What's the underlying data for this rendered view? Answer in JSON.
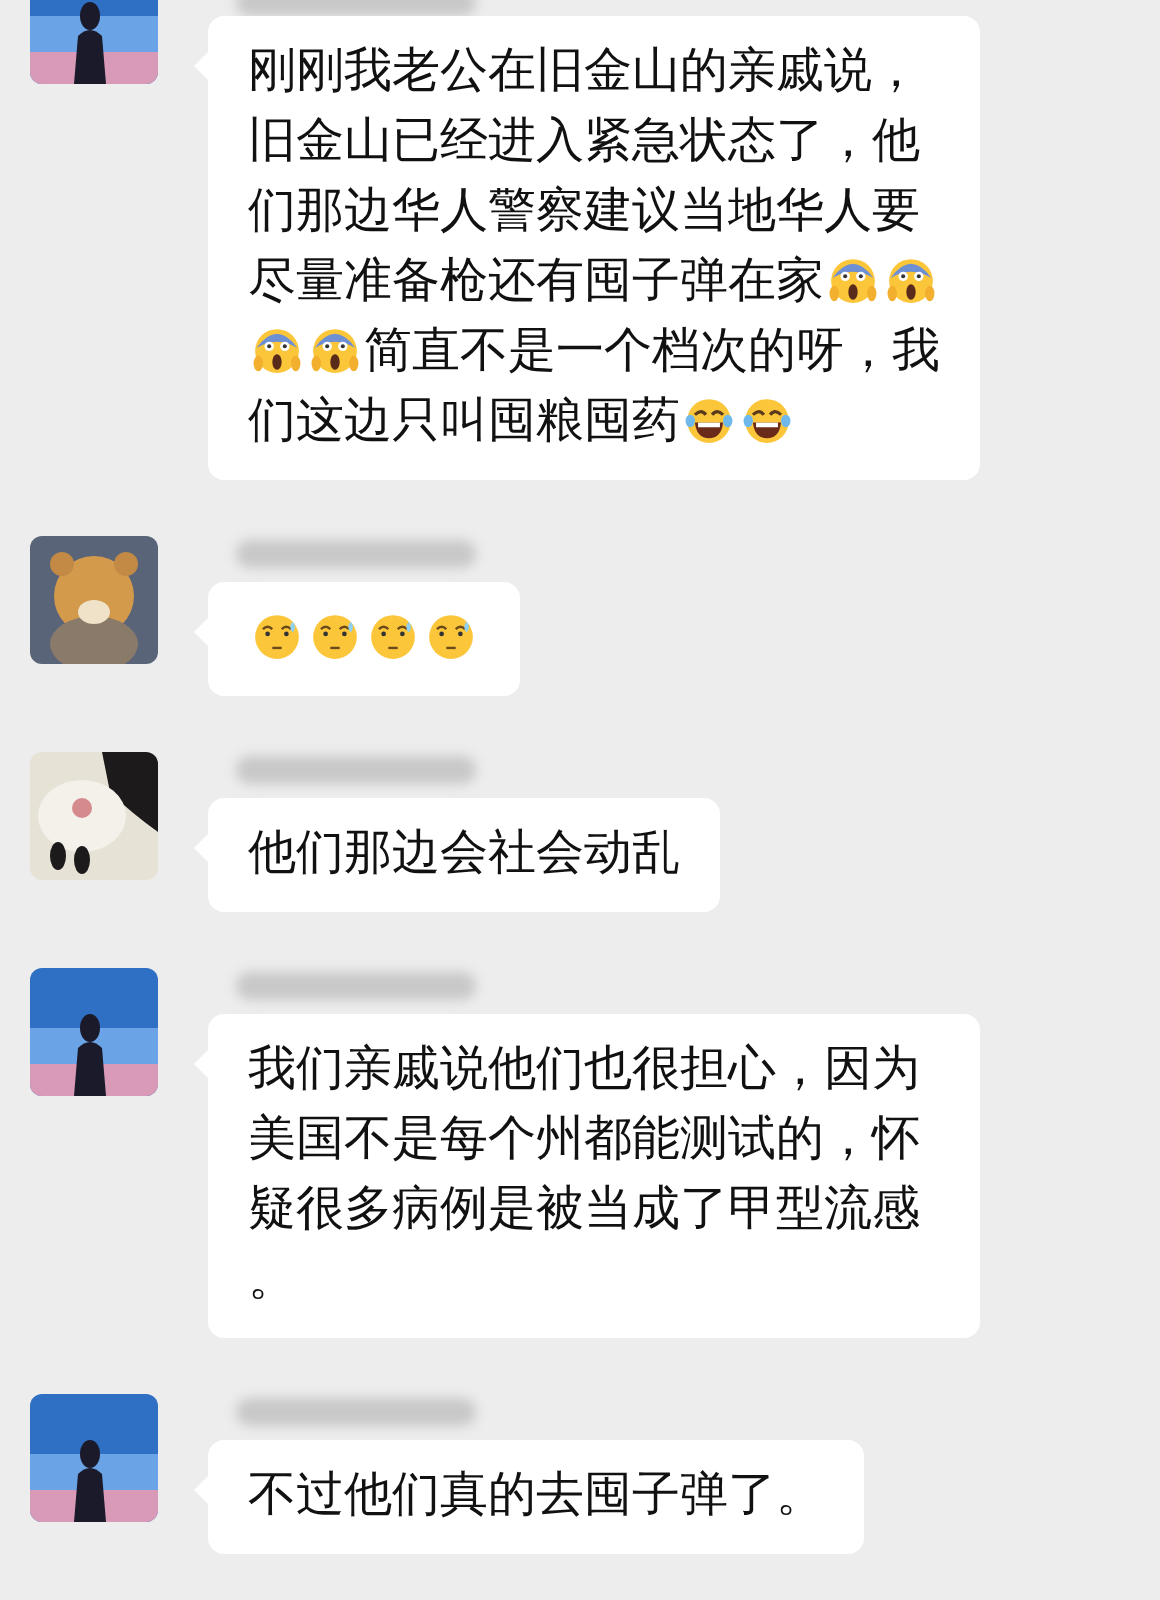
{
  "messages": [
    {
      "parts": [
        {
          "kind": "text",
          "text": "刚刚我老公在旧金山的亲戚说，旧金山已经进入紧急状态了，他们那边华人警察建议当地华人要尽量准备枪还有囤子弹在家"
        },
        {
          "kind": "scream"
        },
        {
          "kind": "scream"
        },
        {
          "kind": "scream"
        },
        {
          "kind": "scream"
        },
        {
          "kind": "text",
          "text": "简直不是一个档次的呀，我们这边只叫囤粮囤药"
        },
        {
          "kind": "laugh"
        },
        {
          "kind": "laugh"
        }
      ]
    },
    {
      "parts": [
        {
          "kind": "awkward"
        },
        {
          "kind": "awkward"
        },
        {
          "kind": "awkward"
        },
        {
          "kind": "awkward"
        }
      ]
    },
    {
      "parts": [
        {
          "kind": "text",
          "text": "他们那边会社会动乱"
        }
      ]
    },
    {
      "parts": [
        {
          "kind": "text",
          "text": "我们亲戚说他们也很担心，因为美国不是每个州都能测试的，怀疑很多病例是被当成了甲型流感。"
        }
      ]
    },
    {
      "parts": [
        {
          "kind": "text",
          "text": "不过他们真的去囤子弹了。"
        }
      ]
    }
  ]
}
